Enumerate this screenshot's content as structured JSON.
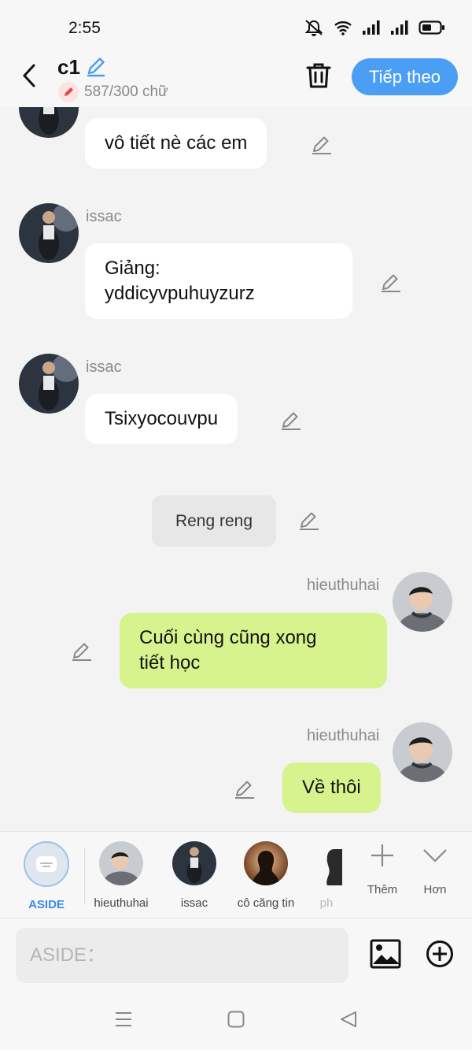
{
  "status_bar": {
    "time": "2:55"
  },
  "header": {
    "title": "c1",
    "word_count": "587/300 chữ",
    "next_label": "Tiếp theo"
  },
  "messages": [
    {
      "type": "left",
      "sender": "",
      "text": "vô tiết nè các em"
    },
    {
      "type": "left",
      "sender": "issac",
      "lines": [
        "Giảng:",
        "yddicyvpuhuyzurz"
      ]
    },
    {
      "type": "left",
      "sender": "issac",
      "text": "Tsixyocouvpu"
    },
    {
      "type": "narration",
      "text": "Reng reng"
    },
    {
      "type": "right",
      "sender": "hieuthuhai",
      "lines": [
        "Cuối cùng cũng xong",
        "tiết học"
      ]
    },
    {
      "type": "right",
      "sender": "hieuthuhai",
      "text": "Về thôi"
    }
  ],
  "characters": [
    {
      "label": "ASIDE"
    },
    {
      "label": "hieuthuhai"
    },
    {
      "label": "issac"
    },
    {
      "label": "cô căng tin"
    },
    {
      "label": "ph"
    }
  ],
  "tools": {
    "more_label": "Thêm",
    "less_label": "Hơn"
  },
  "input": {
    "placeholder": "ASIDE："
  },
  "colors": {
    "accent": "#4a9ff5",
    "my_bubble": "#d7f38e",
    "background": "#f3f3f3"
  }
}
